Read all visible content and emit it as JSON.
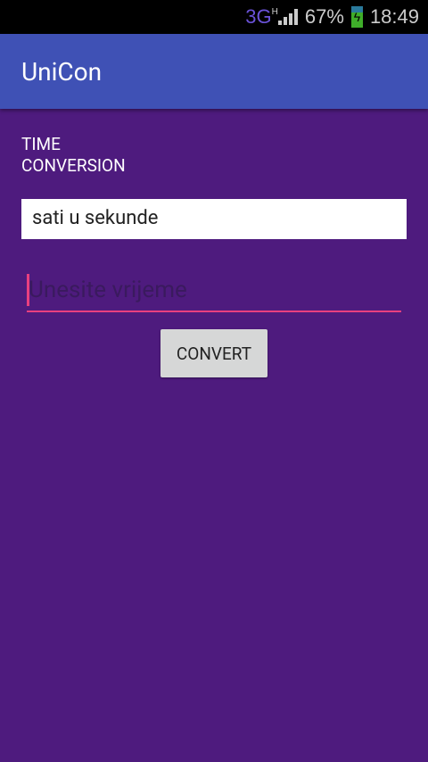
{
  "status": {
    "network": "3G",
    "network_sub": "H",
    "battery": "67%",
    "time": "18:49"
  },
  "app": {
    "title": "UniCon"
  },
  "main": {
    "heading": "TIME CONVERSION",
    "spinner_value": "sati u sekunde",
    "input_placeholder": "Unesite vrijeme",
    "input_value": "",
    "convert_label": "CONVERT"
  }
}
